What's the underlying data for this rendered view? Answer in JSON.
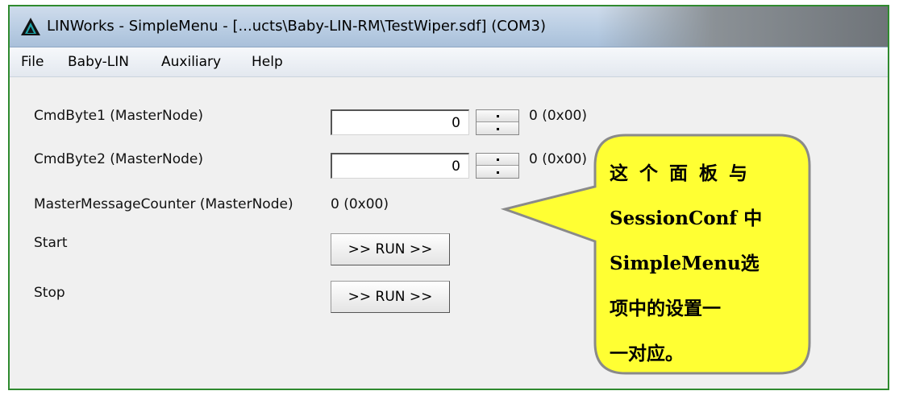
{
  "window": {
    "title": "LINWorks - SimpleMenu - [...ucts\\Baby-LIN-RM\\TestWiper.sdf] (COM3)",
    "icon": "linworks-logo-icon"
  },
  "menu": {
    "items": [
      {
        "label": "File"
      },
      {
        "label": "Baby-LIN"
      },
      {
        "label": "Auxiliary"
      },
      {
        "label": "Help"
      }
    ]
  },
  "panel": {
    "cmdbyte1": {
      "label": "CmdByte1 (MasterNode)",
      "value": "0",
      "readout": "0 (0x00)"
    },
    "cmdbyte2": {
      "label": "CmdByte2 (MasterNode)",
      "value": "0",
      "readout": "0 (0x00)"
    },
    "counter": {
      "label": "MasterMessageCounter (MasterNode)",
      "readout": "0 (0x00)"
    },
    "start": {
      "label": "Start",
      "button": ">> RUN >>"
    },
    "stop": {
      "label": "Stop",
      "button": ">> RUN >>"
    }
  },
  "callout": {
    "lines": [
      "这个面板与",
      "SessionConf 中",
      "SimpleMenu选",
      "项中的设置一",
      "一对应。"
    ],
    "fill_color": "#ffff33",
    "border_color": "#8a8a8a"
  },
  "colors": {
    "frame_border": "#2f8a2f",
    "client_bg": "#f0f0f0"
  }
}
